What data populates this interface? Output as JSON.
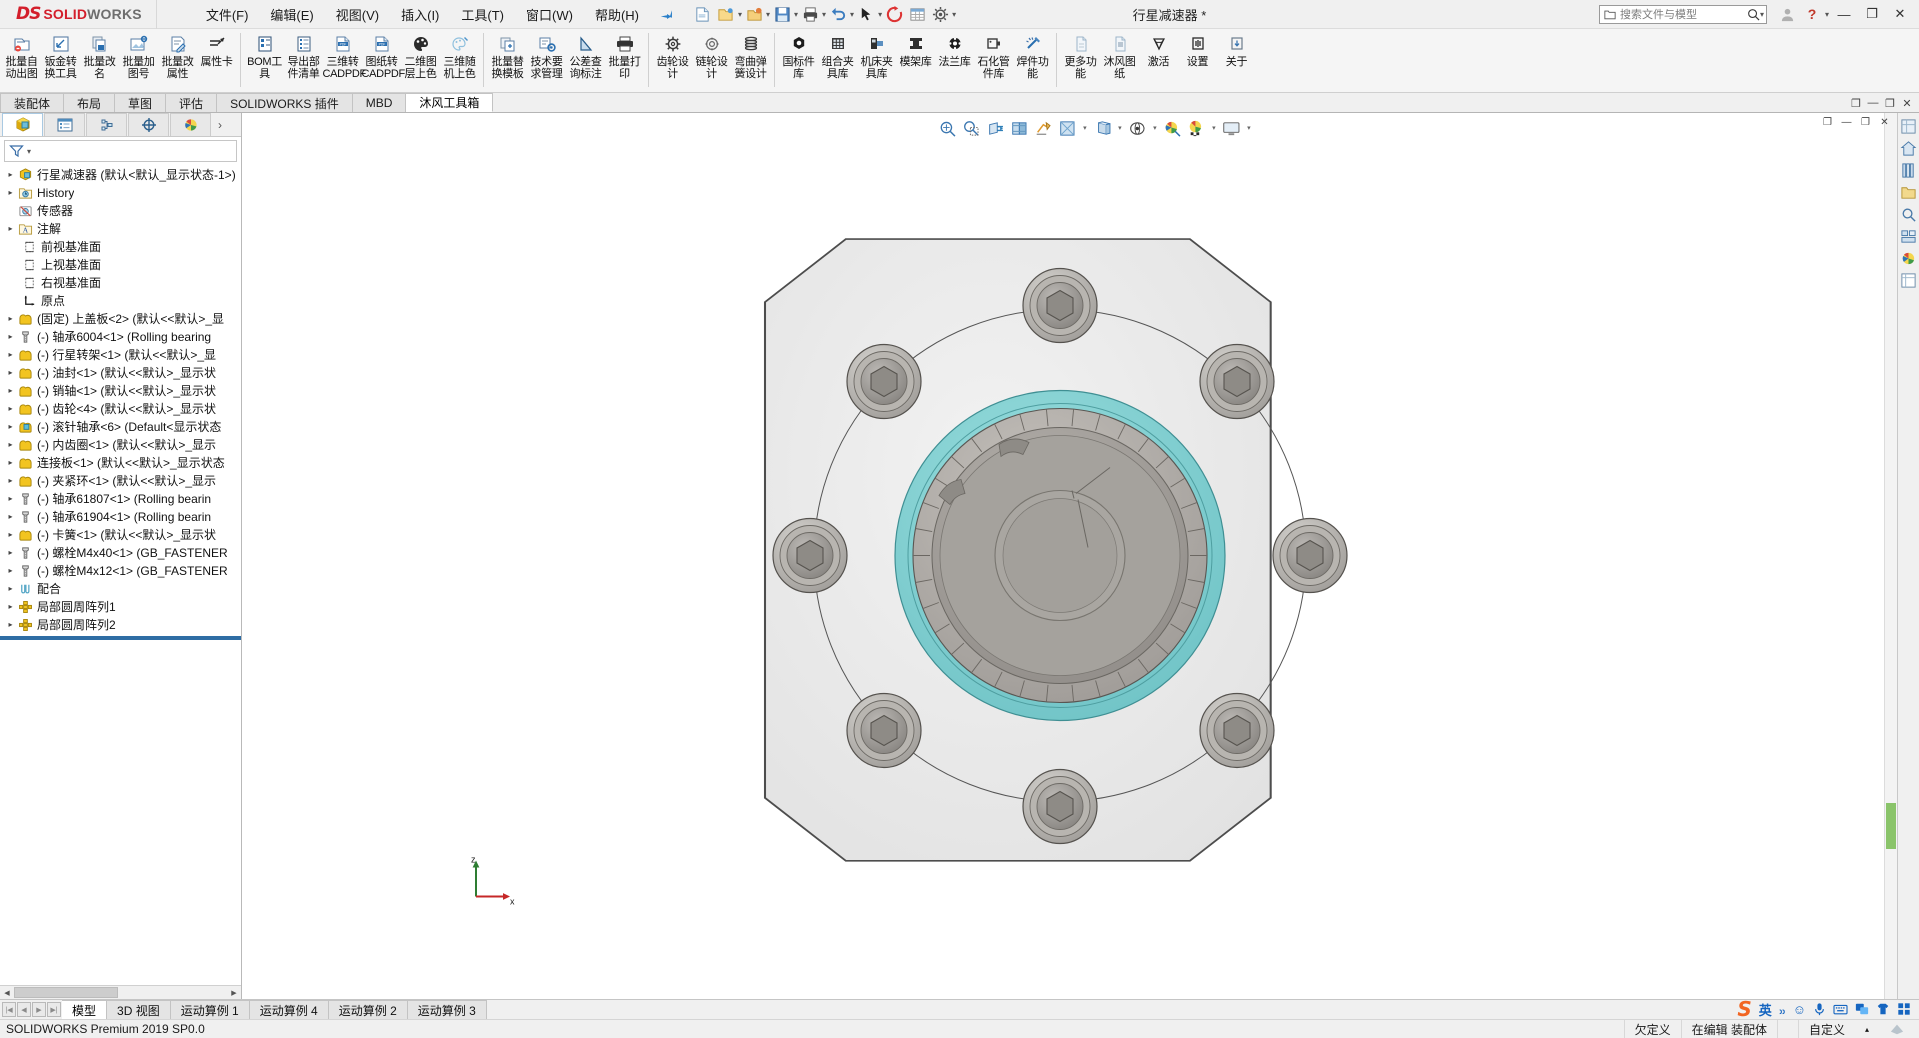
{
  "app": {
    "brand_ds": "DS",
    "brand_solid": "SOLID",
    "brand_works": "WORKS",
    "document_title": "行星减速器 *",
    "accent_red": "#d31e2b",
    "accent_blue": "#2a7fc9"
  },
  "menubar": {
    "items": [
      {
        "label": "文件(F)"
      },
      {
        "label": "编辑(E)"
      },
      {
        "label": "视图(V)"
      },
      {
        "label": "插入(I)"
      },
      {
        "label": "工具(T)"
      },
      {
        "label": "窗口(W)"
      },
      {
        "label": "帮助(H)"
      }
    ],
    "pin_icon": "pushpin-icon"
  },
  "search": {
    "placeholder": "搜索文件与模型",
    "folder_icon": "folder-icon",
    "magnifier_icon": "search-icon"
  },
  "titlebar_right": {
    "user_icon": "user-account-icon",
    "help_icon": "help-question-icon",
    "minimize": "—",
    "restore": "❐",
    "close": "✕"
  },
  "ribbon": {
    "groups": [
      {
        "buttons": [
          {
            "label": "批量自动出图",
            "icon": "batch-auto-drawing-icon"
          },
          {
            "label": "钣金转换工具",
            "icon": "sheetmetal-convert-icon"
          },
          {
            "label": "批量改名",
            "icon": "batch-rename-icon"
          },
          {
            "label": "批量加图号",
            "icon": "batch-add-number-icon"
          },
          {
            "label": "批量改属性",
            "icon": "batch-edit-property-icon"
          },
          {
            "label": "属性卡",
            "icon": "property-card-icon"
          }
        ]
      },
      {
        "buttons": [
          {
            "label": "BOM工具",
            "icon": "bom-tool-icon"
          },
          {
            "label": "导出部件清单",
            "icon": "export-partlist-icon"
          },
          {
            "label": "三维转CADPDF",
            "icon": "3d-to-pdf-icon"
          },
          {
            "label": "图纸转CADPDF",
            "icon": "drawing-to-pdf-icon"
          },
          {
            "label": "二维图层上色",
            "icon": "2d-layer-color-icon"
          },
          {
            "label": "三维随机上色",
            "icon": "3d-random-color-icon"
          }
        ]
      },
      {
        "buttons": [
          {
            "label": "批量替换模板",
            "icon": "batch-replace-template-icon"
          },
          {
            "label": "技术要求管理",
            "icon": "tech-requirement-icon"
          },
          {
            "label": "公差查询标注",
            "icon": "tolerance-query-icon"
          },
          {
            "label": "批量打印",
            "icon": "batch-print-icon"
          }
        ]
      },
      {
        "buttons": [
          {
            "label": "齿轮设计",
            "icon": "gear-design-icon"
          },
          {
            "label": "链轮设计",
            "icon": "sprocket-design-icon"
          },
          {
            "label": "弯曲弹簧设计",
            "icon": "spring-design-icon"
          }
        ]
      },
      {
        "buttons": [
          {
            "label": "国标件库",
            "icon": "standard-part-library-icon"
          },
          {
            "label": "组合夹具库",
            "icon": "modular-fixture-library-icon"
          },
          {
            "label": "机床夹具库",
            "icon": "machine-fixture-library-icon"
          },
          {
            "label": "模架库",
            "icon": "mold-base-library-icon"
          },
          {
            "label": "法兰库",
            "icon": "flange-library-icon"
          },
          {
            "label": "石化管件库",
            "icon": "pipe-fitting-library-icon"
          },
          {
            "label": "焊件功能",
            "icon": "weldment-icon"
          }
        ]
      },
      {
        "buttons": [
          {
            "label": "更多功能",
            "icon": "more-features-icon"
          },
          {
            "label": "沐风图纸",
            "icon": "mufeng-drawing-icon"
          },
          {
            "label": "激活",
            "icon": "activate-diamond-icon"
          },
          {
            "label": "设置",
            "icon": "settings-icon"
          },
          {
            "label": "关于",
            "icon": "about-icon"
          }
        ]
      }
    ]
  },
  "command_tabs": {
    "items": [
      {
        "label": "装配体",
        "active": false
      },
      {
        "label": "布局",
        "active": false
      },
      {
        "label": "草图",
        "active": false
      },
      {
        "label": "评估",
        "active": false
      },
      {
        "label": "SOLIDWORKS 插件",
        "active": false
      },
      {
        "label": "MBD",
        "active": false
      },
      {
        "label": "沐风工具箱",
        "active": true
      }
    ]
  },
  "tree_panel": {
    "tabs": [
      {
        "icon": "feature-manager-tree-icon",
        "active": true
      },
      {
        "icon": "property-manager-icon",
        "active": false
      },
      {
        "icon": "configuration-manager-icon",
        "active": false
      },
      {
        "icon": "dimxpert-manager-icon",
        "active": false
      },
      {
        "icon": "display-manager-icon",
        "active": false
      }
    ],
    "expand_arrow_icon": "chevron-right-icon",
    "filter_icon": "filter-funnel-icon",
    "nodes": [
      {
        "label": "行星减速器  (默认<默认_显示状态-1>)",
        "icon": "assembly-icon",
        "expandable": true,
        "root": true
      },
      {
        "label": "History",
        "icon": "history-icon",
        "expandable": true
      },
      {
        "label": "传感器",
        "icon": "sensor-icon",
        "expandable": false
      },
      {
        "label": "注解",
        "icon": "annotation-icon",
        "expandable": true
      },
      {
        "label": "前视基准面",
        "icon": "plane-icon",
        "expandable": false
      },
      {
        "label": "上视基准面",
        "icon": "plane-icon",
        "expandable": false
      },
      {
        "label": "右视基准面",
        "icon": "plane-icon",
        "expandable": false
      },
      {
        "label": "原点",
        "icon": "origin-icon",
        "expandable": false
      },
      {
        "label": "(固定) 上盖板<2>  (默认<<默认>_显",
        "icon": "part-icon",
        "expandable": true
      },
      {
        "label": "(-) 轴承6004<1>  (Rolling bearing",
        "icon": "bolt-part-icon",
        "expandable": true
      },
      {
        "label": "(-) 行星转架<1>  (默认<<默认>_显",
        "icon": "part-icon",
        "expandable": true
      },
      {
        "label": "(-) 油封<1>  (默认<<默认>_显示状",
        "icon": "part-icon",
        "expandable": true
      },
      {
        "label": "(-) 销轴<1>  (默认<<默认>_显示状",
        "icon": "part-icon",
        "expandable": true
      },
      {
        "label": "(-) 齿轮<4>  (默认<<默认>_显示状",
        "icon": "part-icon",
        "expandable": true
      },
      {
        "label": "(-) 滚针轴承<6>  (Default<显示状态",
        "icon": "part-blue-icon",
        "expandable": true
      },
      {
        "label": "(-) 内齿圈<1>  (默认<<默认>_显示",
        "icon": "part-icon",
        "expandable": true
      },
      {
        "label": "连接板<1>  (默认<<默认>_显示状态",
        "icon": "part-icon",
        "expandable": true
      },
      {
        "label": "(-) 夹紧环<1>  (默认<<默认>_显示",
        "icon": "part-icon",
        "expandable": true
      },
      {
        "label": "(-) 轴承61807<1>  (Rolling bearin",
        "icon": "bolt-part-icon",
        "expandable": true
      },
      {
        "label": "(-) 轴承61904<1>  (Rolling bearin",
        "icon": "bolt-part-icon",
        "expandable": true
      },
      {
        "label": "(-) 卡簧<1>  (默认<<默认>_显示状",
        "icon": "part-icon",
        "expandable": true
      },
      {
        "label": "(-) 螺栓M4x40<1>  (GB_FASTENER",
        "icon": "bolt-part-icon",
        "expandable": true
      },
      {
        "label": "(-) 螺栓M4x12<1>  (GB_FASTENER",
        "icon": "bolt-part-icon",
        "expandable": true
      },
      {
        "label": "配合",
        "icon": "mates-icon",
        "expandable": true
      },
      {
        "label": "局部圆周阵列1",
        "icon": "circular-pattern-icon",
        "expandable": true
      },
      {
        "label": "局部圆周阵列2",
        "icon": "circular-pattern-icon",
        "expandable": true
      }
    ]
  },
  "heads_up_toolbar": {
    "buttons": [
      {
        "icon": "zoom-to-fit-icon",
        "caret": false
      },
      {
        "icon": "zoom-to-area-icon",
        "caret": false
      },
      {
        "icon": "section-view-icon",
        "caret": false
      },
      {
        "icon": "view-orientation-icon",
        "caret": false
      },
      {
        "icon": "3d-drawing-view-icon",
        "caret": false
      },
      {
        "icon": "display-style-icon",
        "caret": true
      },
      {
        "icon": "hide-show-items-icon",
        "caret": true
      },
      {
        "icon": "edit-appearance-icon",
        "caret": true
      },
      {
        "icon": "apply-scene-icon",
        "caret": true
      },
      {
        "icon": "view-settings-icon",
        "caret": true
      }
    ]
  },
  "right_toolbar": {
    "buttons": [
      {
        "icon": "view-palette-icon"
      },
      {
        "icon": "home-icon"
      },
      {
        "icon": "design-library-icon"
      },
      {
        "icon": "file-explorer-icon"
      },
      {
        "icon": "search-library-icon"
      },
      {
        "icon": "view-palette2-icon"
      },
      {
        "icon": "appearances-icon"
      },
      {
        "icon": "custom-properties-icon"
      }
    ]
  },
  "viewport": {
    "window_buttons": [
      {
        "icon": "restore-window-icon"
      },
      {
        "icon": "minimize-window-icon"
      },
      {
        "icon": "maximize-window-icon"
      },
      {
        "icon": "close-window-icon"
      }
    ],
    "triad": {
      "z_label": "z",
      "x_label": "x"
    },
    "model_name": "行星减速器",
    "scrollbar_color": "#8ac46a"
  },
  "bottom_tabs": {
    "nav_icons": [
      "first-icon",
      "prev-icon",
      "next-icon",
      "last-icon"
    ],
    "items": [
      {
        "label": "模型",
        "active": true
      },
      {
        "label": "3D 视图",
        "active": false
      },
      {
        "label": "运动算例 1",
        "active": false
      },
      {
        "label": "运动算例 4",
        "active": false
      },
      {
        "label": "运动算例 2",
        "active": false
      },
      {
        "label": "运动算例 3",
        "active": false
      }
    ]
  },
  "status_bar": {
    "left": "SOLIDWORKS Premium 2019 SP0.0",
    "cells": [
      "欠定义",
      "在编辑 装配体",
      "",
      "自定义"
    ]
  },
  "ime_bar": {
    "sogou_logo": "S",
    "mode": "英",
    "items": [
      "punctuation-icon",
      "emoji-icon",
      "voice-icon",
      "keyboard-icon",
      "translate-icon",
      "skin-icon",
      "apps-icon"
    ]
  }
}
